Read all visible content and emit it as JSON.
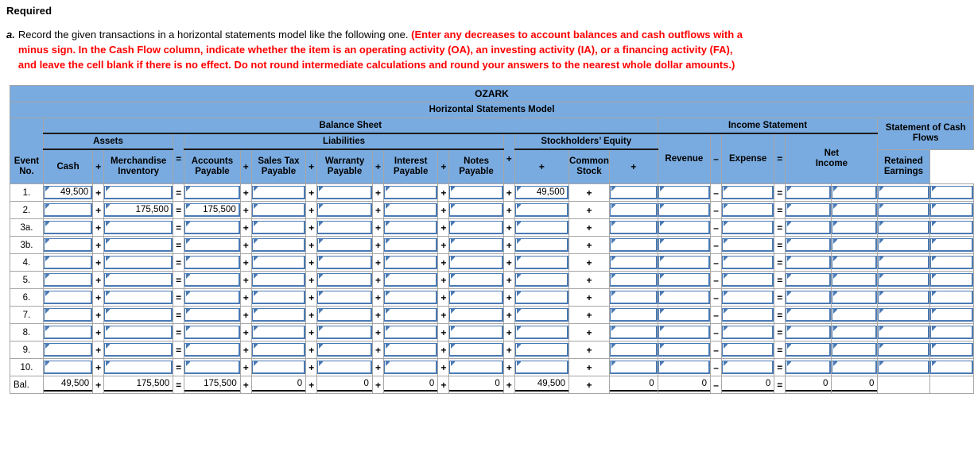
{
  "instructions": {
    "required_heading": "Required",
    "item_letter": "a.",
    "black_text": "Record the given transactions in a horizontal statements model like the following one.",
    "red_text": "(Enter any decreases to account balances and cash outflows with a minus sign. In the Cash Flow column, indicate whether the item is an operating activity (OA), an investing activity (IA), or a financing activity (FA), and leave the cell blank if there is no effect. Do not round intermediate calculations and round your answers to the nearest whole dollar amounts.)",
    "red_color": "#ff0000"
  },
  "table": {
    "company_name": "OZARK",
    "model_title": "Horizontal Statements Model",
    "header_bg": "#79abe0",
    "groups": {
      "balance_sheet": "Balance Sheet",
      "income_statement": "Income Statement",
      "assets": "Assets",
      "liabilities": "Liabilities",
      "stockholders_equity": "Stockholders’ Equity",
      "statement_of_cash_flows": "Statement of Cash Flows"
    },
    "event_col_header_line1": "Event",
    "event_col_header_line2": "No.",
    "columns": [
      {
        "key": "cash",
        "label_line1": "Cash",
        "label_line2": ""
      },
      {
        "key": "merchandise_inventory",
        "label_line1": "Merchandise",
        "label_line2": "Inventory"
      },
      {
        "key": "accounts_payable",
        "label_line1": "Accounts",
        "label_line2": "Payable"
      },
      {
        "key": "sales_tax_payable",
        "label_line1": "Sales Tax",
        "label_line2": "Payable"
      },
      {
        "key": "warranty_payable",
        "label_line1": "Warranty",
        "label_line2": "Payable"
      },
      {
        "key": "interest_payable",
        "label_line1": "Interest",
        "label_line2": "Payable"
      },
      {
        "key": "notes_payable",
        "label_line1": "Notes",
        "label_line2": "Payable"
      },
      {
        "key": "common_stock",
        "label_line1": "Common",
        "label_line2": "Stock"
      },
      {
        "key": "retained_earnings",
        "label_line1": "Retained",
        "label_line2": "Earnings"
      },
      {
        "key": "revenue",
        "label_line1": "Revenue",
        "label_line2": ""
      },
      {
        "key": "expense",
        "label_line1": "Expense",
        "label_line2": ""
      },
      {
        "key": "net_income",
        "label_line1": "Net",
        "label_line2": "Income"
      }
    ],
    "operators": {
      "plus": "+",
      "equals": "=",
      "minus": "–"
    },
    "rows": [
      {
        "event": "1.",
        "cash": "49,500",
        "merchandise_inventory": "",
        "accounts_payable": "",
        "sales_tax_payable": "",
        "warranty_payable": "",
        "interest_payable": "",
        "notes_payable": "",
        "common_stock": "49,500",
        "retained_earnings": "",
        "revenue": "",
        "expense": "",
        "net_income_a": "",
        "net_income_b": "",
        "cash_flow_a": "",
        "cash_flow_b": ""
      },
      {
        "event": "2.",
        "cash": "",
        "merchandise_inventory": "175,500",
        "accounts_payable": "175,500",
        "sales_tax_payable": "",
        "warranty_payable": "",
        "interest_payable": "",
        "notes_payable": "",
        "common_stock": "",
        "retained_earnings": "",
        "revenue": "",
        "expense": "",
        "net_income_a": "",
        "net_income_b": "",
        "cash_flow_a": "",
        "cash_flow_b": ""
      },
      {
        "event": "3a.",
        "cash": "",
        "merchandise_inventory": "",
        "accounts_payable": "",
        "sales_tax_payable": "",
        "warranty_payable": "",
        "interest_payable": "",
        "notes_payable": "",
        "common_stock": "",
        "retained_earnings": "",
        "revenue": "",
        "expense": "",
        "net_income_a": "",
        "net_income_b": "",
        "cash_flow_a": "",
        "cash_flow_b": ""
      },
      {
        "event": "3b.",
        "cash": "",
        "merchandise_inventory": "",
        "accounts_payable": "",
        "sales_tax_payable": "",
        "warranty_payable": "",
        "interest_payable": "",
        "notes_payable": "",
        "common_stock": "",
        "retained_earnings": "",
        "revenue": "",
        "expense": "",
        "net_income_a": "",
        "net_income_b": "",
        "cash_flow_a": "",
        "cash_flow_b": ""
      },
      {
        "event": "4.",
        "cash": "",
        "merchandise_inventory": "",
        "accounts_payable": "",
        "sales_tax_payable": "",
        "warranty_payable": "",
        "interest_payable": "",
        "notes_payable": "",
        "common_stock": "",
        "retained_earnings": "",
        "revenue": "",
        "expense": "",
        "net_income_a": "",
        "net_income_b": "",
        "cash_flow_a": "",
        "cash_flow_b": ""
      },
      {
        "event": "5.",
        "cash": "",
        "merchandise_inventory": "",
        "accounts_payable": "",
        "sales_tax_payable": "",
        "warranty_payable": "",
        "interest_payable": "",
        "notes_payable": "",
        "common_stock": "",
        "retained_earnings": "",
        "revenue": "",
        "expense": "",
        "net_income_a": "",
        "net_income_b": "",
        "cash_flow_a": "",
        "cash_flow_b": ""
      },
      {
        "event": "6.",
        "cash": "",
        "merchandise_inventory": "",
        "accounts_payable": "",
        "sales_tax_payable": "",
        "warranty_payable": "",
        "interest_payable": "",
        "notes_payable": "",
        "common_stock": "",
        "retained_earnings": "",
        "revenue": "",
        "expense": "",
        "net_income_a": "",
        "net_income_b": "",
        "cash_flow_a": "",
        "cash_flow_b": ""
      },
      {
        "event": "7.",
        "cash": "",
        "merchandise_inventory": "",
        "accounts_payable": "",
        "sales_tax_payable": "",
        "warranty_payable": "",
        "interest_payable": "",
        "notes_payable": "",
        "common_stock": "",
        "retained_earnings": "",
        "revenue": "",
        "expense": "",
        "net_income_a": "",
        "net_income_b": "",
        "cash_flow_a": "",
        "cash_flow_b": ""
      },
      {
        "event": "8.",
        "cash": "",
        "merchandise_inventory": "",
        "accounts_payable": "",
        "sales_tax_payable": "",
        "warranty_payable": "",
        "interest_payable": "",
        "notes_payable": "",
        "common_stock": "",
        "retained_earnings": "",
        "revenue": "",
        "expense": "",
        "net_income_a": "",
        "net_income_b": "",
        "cash_flow_a": "",
        "cash_flow_b": ""
      },
      {
        "event": "9.",
        "cash": "",
        "merchandise_inventory": "",
        "accounts_payable": "",
        "sales_tax_payable": "",
        "warranty_payable": "",
        "interest_payable": "",
        "notes_payable": "",
        "common_stock": "",
        "retained_earnings": "",
        "revenue": "",
        "expense": "",
        "net_income_a": "",
        "net_income_b": "",
        "cash_flow_a": "",
        "cash_flow_b": ""
      },
      {
        "event": "10.",
        "cash": "",
        "merchandise_inventory": "",
        "accounts_payable": "",
        "sales_tax_payable": "",
        "warranty_payable": "",
        "interest_payable": "",
        "notes_payable": "",
        "common_stock": "",
        "retained_earnings": "",
        "revenue": "",
        "expense": "",
        "net_income_a": "",
        "net_income_b": "",
        "cash_flow_a": "",
        "cash_flow_b": ""
      }
    ],
    "balance_row": {
      "event": "Bal.",
      "cash": "49,500",
      "merchandise_inventory": "175,500",
      "accounts_payable": "175,500",
      "sales_tax_payable": "0",
      "warranty_payable": "0",
      "interest_payable": "0",
      "notes_payable": "0",
      "common_stock": "49,500",
      "retained_earnings": "0",
      "revenue": "0",
      "expense": "0",
      "net_income_a": "0",
      "net_income_b": "0",
      "cash_flow_a": "",
      "cash_flow_b": ""
    }
  }
}
